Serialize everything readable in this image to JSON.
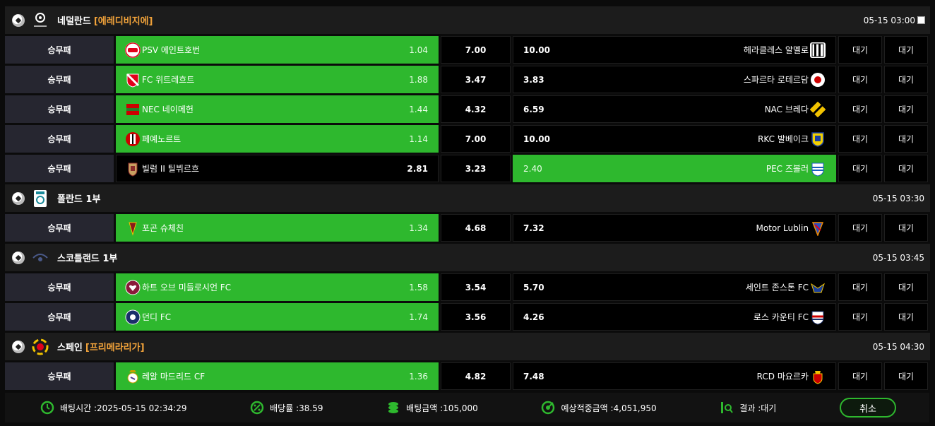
{
  "leagues": [
    {
      "name": "네덜란드",
      "sub": "[에레디비지에]",
      "time": "05-15 03:00",
      "matches": [
        {
          "type": "승무패",
          "home": "PSV 에인트호번",
          "home_odd": "1.04",
          "draw": "7.00",
          "away_odd": "10.00",
          "away": "헤라클레스 알멜로",
          "wait1": "대기",
          "wait2": "대기",
          "selected": "home"
        },
        {
          "type": "승무패",
          "home": "FC 위트레흐트",
          "home_odd": "1.88",
          "draw": "3.47",
          "away_odd": "3.83",
          "away": "스파르타 로테르담",
          "wait1": "대기",
          "wait2": "대기",
          "selected": "home"
        },
        {
          "type": "승무패",
          "home": "NEC 네이메헌",
          "home_odd": "1.44",
          "draw": "4.32",
          "away_odd": "6.59",
          "away": "NAC 브레다",
          "wait1": "대기",
          "wait2": "대기",
          "selected": "home"
        },
        {
          "type": "승무패",
          "home": "페예노르트",
          "home_odd": "1.14",
          "draw": "7.00",
          "away_odd": "10.00",
          "away": "RKC 발베이크",
          "wait1": "대기",
          "wait2": "대기",
          "selected": "home"
        },
        {
          "type": "승무패",
          "home": "빌럼 II 틸뷔르흐",
          "home_odd": "2.81",
          "draw": "3.23",
          "away_odd": "2.40",
          "away": "PEC 즈볼러",
          "wait1": "대기",
          "wait2": "대기",
          "selected": "away"
        }
      ]
    },
    {
      "name": "폴란드 1부",
      "sub": "",
      "time": "05-15 03:30",
      "matches": [
        {
          "type": "승무패",
          "home": "포곤 슈체친",
          "home_odd": "1.34",
          "draw": "4.68",
          "away_odd": "7.32",
          "away": "Motor Lublin",
          "wait1": "대기",
          "wait2": "대기",
          "selected": "home"
        }
      ]
    },
    {
      "name": "스코틀랜드 1부",
      "sub": "",
      "time": "05-15 03:45",
      "matches": [
        {
          "type": "승무패",
          "home": "하트 오브 미들로시언 FC",
          "home_odd": "1.58",
          "draw": "3.54",
          "away_odd": "5.70",
          "away": "세인트 존스톤 FC",
          "wait1": "대기",
          "wait2": "대기",
          "selected": "home"
        },
        {
          "type": "승무패",
          "home": "던디 FC",
          "home_odd": "1.74",
          "draw": "3.56",
          "away_odd": "4.26",
          "away": "로스 카운티 FC",
          "wait1": "대기",
          "wait2": "대기",
          "selected": "home"
        }
      ]
    },
    {
      "name": "스페인",
      "sub": "[프리메라리가]",
      "time": "05-15 04:30",
      "matches": [
        {
          "type": "승무패",
          "home": "레알 마드리드 CF",
          "home_odd": "1.36",
          "draw": "4.82",
          "away_odd": "7.48",
          "away": "RCD 마요르카",
          "wait1": "대기",
          "wait2": "대기",
          "selected": "home"
        }
      ]
    }
  ],
  "footer": {
    "bet_time": "배팅시간 :2025-05-15 02:34:29",
    "rate": "배당률 :38.59",
    "amount": "배팅금액 :105,000",
    "expected": "예상적중금액 :4,051,950",
    "result": "결과 :대기",
    "cancel": "취소"
  },
  "colors": {
    "accent": "#2eb82e",
    "league_sub": "#f2a33a"
  }
}
